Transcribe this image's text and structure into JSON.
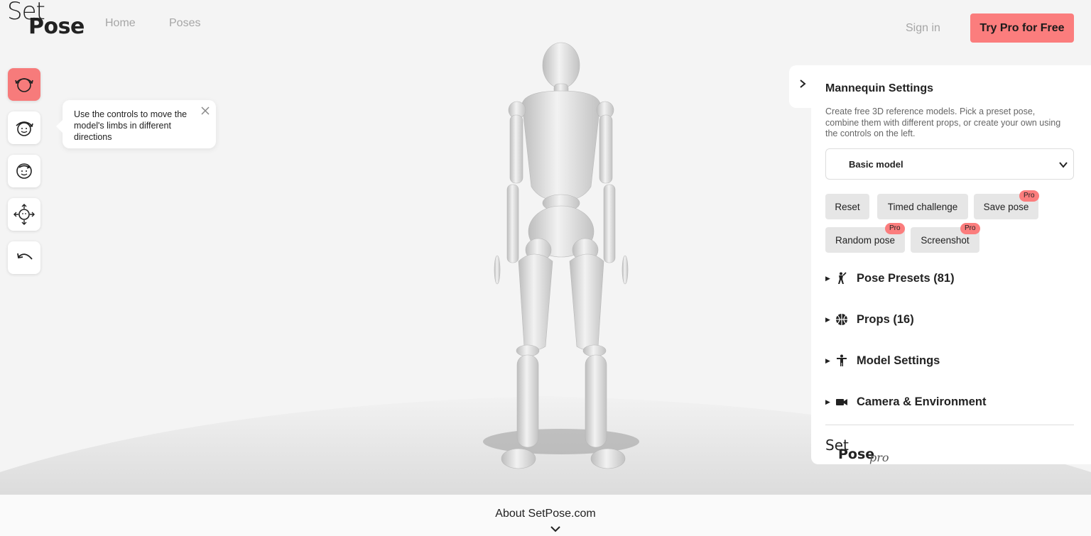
{
  "header": {
    "logo_top": "Set",
    "logo_bottom": "Pose",
    "nav": [
      "Home",
      "Poses"
    ],
    "sign_in": "Sign in",
    "try_pro": "Try Pro for Free"
  },
  "toolbar": {
    "tools": [
      {
        "icon": "rotate-head-icon",
        "active": true
      },
      {
        "icon": "move-head-icon",
        "active": false
      },
      {
        "icon": "twist-head-icon",
        "active": false
      },
      {
        "icon": "move-all-icon",
        "active": false
      },
      {
        "icon": "undo-icon",
        "active": false
      }
    ]
  },
  "tooltip": {
    "text": "Use the controls to move the model's limbs in different directions"
  },
  "panel": {
    "title": "Mannequin Settings",
    "description": "Create free 3D reference models. Pick a preset pose, combine them with different props, or create your own using the controls on the left.",
    "model_select": "Basic model",
    "buttons": {
      "reset": "Reset",
      "timed_challenge": "Timed challenge",
      "save_pose": "Save pose",
      "random_pose": "Random pose",
      "screenshot": "Screenshot"
    },
    "pro_badge": "Pro",
    "sections": {
      "pose_presets": "Pose Presets (81)",
      "props": "Props (16)",
      "model_settings": "Model Settings",
      "camera": "Camera & Environment"
    },
    "pro_logo": {
      "a": "Set",
      "b": "Pose",
      "c": "pro"
    }
  },
  "footer": {
    "about": "About SetPose.com"
  },
  "colors": {
    "accent": "#fb7d7d",
    "background": "#f4f4f4",
    "panel": "#ffffff",
    "nav_muted": "#a6a6a6"
  }
}
